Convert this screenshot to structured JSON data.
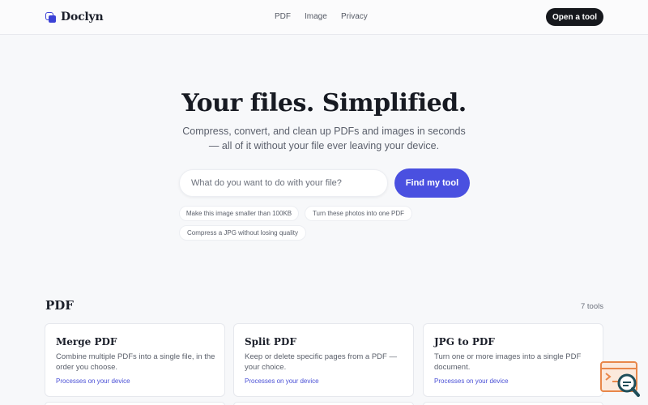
{
  "header": {
    "brand": "Doclyn",
    "nav": [
      "PDF",
      "Image",
      "Privacy"
    ],
    "cta": "Open a tool"
  },
  "hero": {
    "title": "Your files. Simplified.",
    "subtitle": "Compress, convert, and clean up PDFs and images in seconds — all of it without your file ever leaving your device.",
    "search_placeholder": "What do you want to do with your file?",
    "search_button": "Find my tool",
    "suggestions": [
      "Make this image smaller than 100KB",
      "Turn these photos into one PDF",
      "Compress a JPG without losing quality"
    ]
  },
  "section": {
    "title": "PDF",
    "count": "7 tools",
    "cards": [
      {
        "title": "Merge PDF",
        "description": "Combine multiple PDFs into a single file, in the order you choose.",
        "note": "Processes on your device"
      },
      {
        "title": "Split PDF",
        "description": "Keep or delete specific pages from a PDF — your choice.",
        "note": "Processes on your device"
      },
      {
        "title": "JPG to PDF",
        "description": "Turn one or more images into a single PDF document.",
        "note": "Processes on your device"
      }
    ]
  },
  "colors": {
    "accent": "#4a50e0",
    "dark_button": "#16181d",
    "widget_orange": "#e8874a",
    "widget_teal": "#1f4e5a"
  },
  "icons": {
    "logo": "overlapping-squares-icon",
    "widget": "code-search-icon"
  }
}
